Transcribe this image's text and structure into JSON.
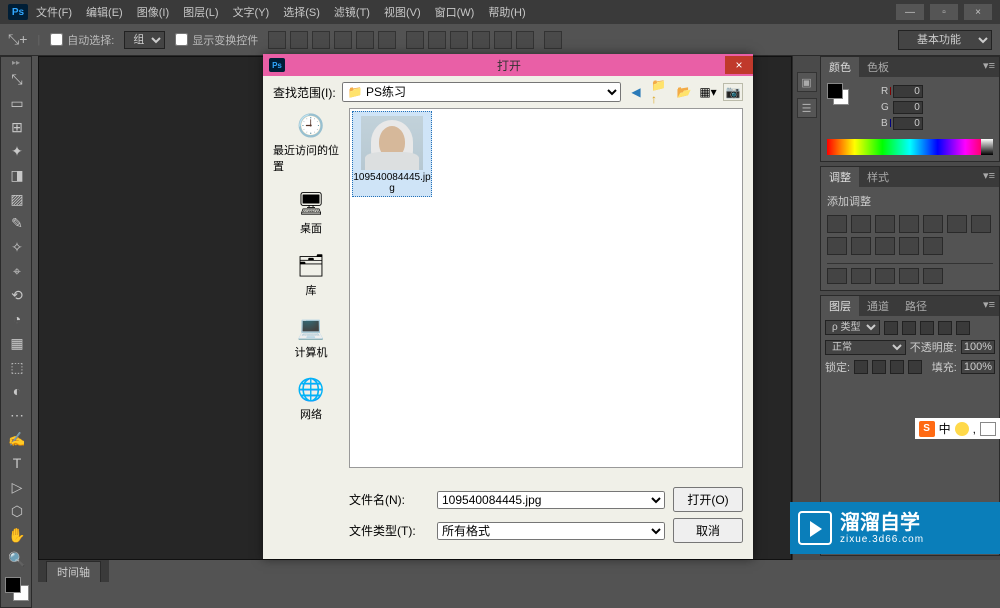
{
  "titlebar": {
    "logo": "Ps",
    "menus": [
      "文件(F)",
      "编辑(E)",
      "图像(I)",
      "图层(L)",
      "文字(Y)",
      "选择(S)",
      "滤镜(T)",
      "视图(V)",
      "窗口(W)",
      "帮助(H)"
    ],
    "win_min": "—",
    "win_max": "▫",
    "win_close": "×"
  },
  "options_bar": {
    "auto_select": "自动选择:",
    "select_mode": "组",
    "show_transform": "显示变换控件",
    "basic_functions": "基本功能"
  },
  "tools": [
    "⤡",
    "▭",
    "⊞",
    "✦",
    "◨",
    "▨",
    "✎",
    "✧",
    "⌖",
    "⟲",
    "◔",
    "▦",
    "⬚",
    "◐",
    "⋯",
    "✍",
    "T",
    "▷",
    "⬡",
    "✋",
    "🔍"
  ],
  "panel_color": {
    "tab1": "颜色",
    "tab2": "色板",
    "r_label": "R",
    "g_label": "G",
    "b_label": "B",
    "r_val": "0",
    "g_val": "0",
    "b_val": "0"
  },
  "panel_adjust": {
    "tab1": "调整",
    "tab2": "样式",
    "add_text": "添加调整"
  },
  "panel_layers": {
    "tab1": "图层",
    "tab2": "通道",
    "tab3": "路径",
    "kind": "ρ 类型",
    "blend": "正常",
    "opacity_label": "不透明度:",
    "opacity_val": "100%",
    "lock_label": "锁定:",
    "fill_label": "填充:",
    "fill_val": "100%"
  },
  "status": {
    "timeline": "时间轴"
  },
  "open_dialog": {
    "title": "打开",
    "look_in_label": "查找范围(I):",
    "look_in_value": "PS练习",
    "places": [
      {
        "icon": "🕘",
        "label": "最近访问的位置"
      },
      {
        "icon": "🖥",
        "label": "桌面"
      },
      {
        "icon": "🗂",
        "label": "库"
      },
      {
        "icon": "💻",
        "label": "计算机"
      },
      {
        "icon": "🌐",
        "label": "网络"
      }
    ],
    "files": [
      {
        "name": "109540084445.jpg",
        "selected": true
      }
    ],
    "filename_label": "文件名(N):",
    "filename_value": "109540084445.jpg",
    "filetype_label": "文件类型(T):",
    "filetype_value": "所有格式",
    "open_btn": "打开(O)",
    "cancel_btn": "取消"
  },
  "watermark": {
    "big": "溜溜自学",
    "small": "zixue.3d66.com"
  },
  "ime": {
    "logo": "S",
    "zhong": "中"
  }
}
